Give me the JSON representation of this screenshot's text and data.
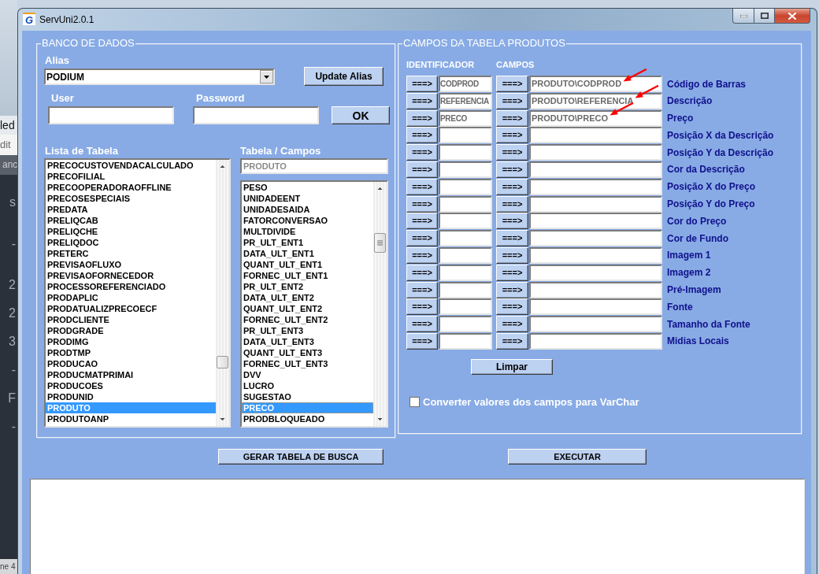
{
  "background_window": {
    "title": "led",
    "menu": "dit",
    "tab": "anc",
    "gutter": [
      "s",
      "-",
      "2",
      "2",
      "3",
      "-",
      "F",
      "-"
    ],
    "status": "ne 4"
  },
  "window": {
    "title": "ServUni2.0.1",
    "logo": "G"
  },
  "database": {
    "title": "BANCO DE DADOS",
    "alias": {
      "label": "Alias",
      "value": "PODIUM"
    },
    "update_alias_button": "Update Alias",
    "user": {
      "label": "User"
    },
    "password": {
      "label": "Password"
    },
    "ok_button": "OK",
    "table_list": {
      "label": "Lista de Tabela",
      "focused": false,
      "items": [
        {
          "text": "PRECOCUSTOVENDACALCULADO",
          "selected": false
        },
        {
          "text": "PRECOFILIAL",
          "selected": false
        },
        {
          "text": "PRECOOPERADORAOFFLINE",
          "selected": false
        },
        {
          "text": "PRECOSESPECIAIS",
          "selected": false
        },
        {
          "text": "PREDATA",
          "selected": false
        },
        {
          "text": "PRELIQCAB",
          "selected": false
        },
        {
          "text": "PRELIQCHE",
          "selected": false
        },
        {
          "text": "PRELIQDOC",
          "selected": false
        },
        {
          "text": "PRETERC",
          "selected": false
        },
        {
          "text": "PREVISAOFLUXO",
          "selected": false
        },
        {
          "text": "PREVISAOFORNECEDOR",
          "selected": false
        },
        {
          "text": "PROCESSOREFERENCIADO",
          "selected": false
        },
        {
          "text": "PRODAPLIC",
          "selected": false
        },
        {
          "text": "PRODATUALIZPRECOECF",
          "selected": false
        },
        {
          "text": "PRODCLIENTE",
          "selected": false
        },
        {
          "text": "PRODGRADE",
          "selected": false
        },
        {
          "text": "PRODIMG",
          "selected": false
        },
        {
          "text": "PRODTMP",
          "selected": false
        },
        {
          "text": "PRODUCAO",
          "selected": false
        },
        {
          "text": "PRODUCMATPRIMAI",
          "selected": false
        },
        {
          "text": "PRODUCOES",
          "selected": false
        },
        {
          "text": "PRODUNID",
          "selected": false
        },
        {
          "text": "PRODUTO",
          "selected": true
        },
        {
          "text": "PRODUTOANP",
          "selected": false
        }
      ]
    },
    "table_fields": {
      "label": "Tabela / Campos",
      "table": "PRODUTO",
      "focused": true,
      "items": [
        {
          "text": "PESO",
          "selected": false
        },
        {
          "text": "UNIDADEENT",
          "selected": false
        },
        {
          "text": "UNIDADESAIDA",
          "selected": false
        },
        {
          "text": "FATORCONVERSAO",
          "selected": false
        },
        {
          "text": "MULTDIVIDE",
          "selected": false
        },
        {
          "text": "PR_ULT_ENT1",
          "selected": false
        },
        {
          "text": "DATA_ULT_ENT1",
          "selected": false
        },
        {
          "text": "QUANT_ULT_ENT1",
          "selected": false
        },
        {
          "text": "FORNEC_ULT_ENT1",
          "selected": false
        },
        {
          "text": "PR_ULT_ENT2",
          "selected": false
        },
        {
          "text": "DATA_ULT_ENT2",
          "selected": false
        },
        {
          "text": "QUANT_ULT_ENT2",
          "selected": false
        },
        {
          "text": "FORNEC_ULT_ENT2",
          "selected": false
        },
        {
          "text": "PR_ULT_ENT3",
          "selected": false
        },
        {
          "text": "DATA_ULT_ENT3",
          "selected": false
        },
        {
          "text": "QUANT_ULT_ENT3",
          "selected": false
        },
        {
          "text": "FORNEC_ULT_ENT3",
          "selected": false
        },
        {
          "text": "DVV",
          "selected": false
        },
        {
          "text": "LUCRO",
          "selected": false
        },
        {
          "text": "SUGESTAO",
          "selected": false
        },
        {
          "text": "PRECO",
          "selected": true
        },
        {
          "text": "PRODBLOQUEADO",
          "selected": false
        }
      ]
    }
  },
  "product_fields": {
    "title": "CAMPOS DA TABELA PRODUTOS",
    "column_headers": [
      "IDENTIFICADOR",
      "CAMPOS"
    ],
    "rows": [
      {
        "identifier_button": "===>",
        "identifier": "CODPROD",
        "field_button": "===>",
        "field": "PRODUTO\\CODPROD",
        "label": "Código de Barras",
        "marked": true
      },
      {
        "identifier_button": "===>",
        "identifier": "REFERENCIA",
        "field_button": "===>",
        "field": "PRODUTO\\REFERENCIA",
        "label": "Descrição",
        "marked": true
      },
      {
        "identifier_button": "===>",
        "identifier": "PRECO",
        "field_button": "===>",
        "field": "PRODUTO\\PRECO",
        "label": "Preço",
        "marked": true
      },
      {
        "identifier_button": "===>",
        "field_button": "===>",
        "label": "Posição X da Descrição",
        "marked": false
      },
      {
        "identifier_button": "===>",
        "field_button": "===>",
        "label": "Posição Y da Descrição",
        "marked": false
      },
      {
        "identifier_button": "===>",
        "field_button": "===>",
        "label": "Cor da Descrição",
        "marked": false
      },
      {
        "identifier_button": "===>",
        "field_button": "===>",
        "label": "Posição X do Preço",
        "marked": false
      },
      {
        "identifier_button": "===>",
        "field_button": "===>",
        "label": "Posição Y do Preço",
        "marked": false
      },
      {
        "identifier_button": "===>",
        "field_button": "===>",
        "label": "Cor do Preço",
        "marked": false
      },
      {
        "identifier_button": "===>",
        "field_button": "===>",
        "label": "Cor de Fundo",
        "marked": false
      },
      {
        "identifier_button": "===>",
        "field_button": "===>",
        "label": "Imagem 1",
        "marked": false
      },
      {
        "identifier_button": "===>",
        "field_button": "===>",
        "label": "Imagem 2",
        "marked": false
      },
      {
        "identifier_button": "===>",
        "field_button": "===>",
        "label": "Pré-Imagem",
        "marked": false
      },
      {
        "identifier_button": "===>",
        "field_button": "===>",
        "label": "Fonte",
        "marked": false
      },
      {
        "identifier_button": "===>",
        "field_button": "===>",
        "label": "Tamanho da Fonte",
        "marked": false
      },
      {
        "identifier_button": "===>",
        "field_button": "===>",
        "label": "Midias Locais",
        "marked": false
      }
    ],
    "clear_button": "Limpar",
    "convert_varchar": {
      "label": "Converter valores dos campos para VarChar",
      "checked": false
    }
  },
  "generate_button": "GERAR TABELA DE BUSCA",
  "execute_button": "EXECUTAR"
}
